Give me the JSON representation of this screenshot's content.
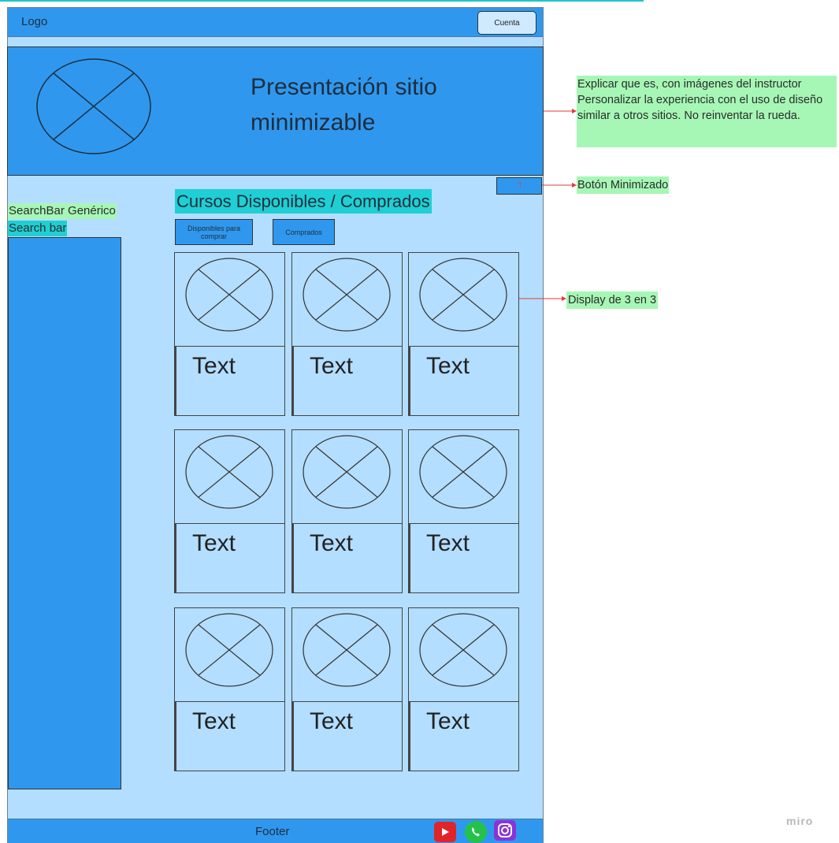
{
  "header": {
    "logo": "Logo",
    "account_button": "Cuenta"
  },
  "hero": {
    "title": "Presentación sitio minimizable"
  },
  "annotations": {
    "hero_note": "Explicar que es, con imágenes del instructor Personalizar la experiencia con el uso de diseño similar a otros sitios. No reinventar la rueda.",
    "minimize_note": "Botón Minimizado",
    "grid_note": "Display de 3 en 3",
    "search_generic": "SearchBar Genérico",
    "search_bar": "Search bar"
  },
  "section": {
    "title": "Cursos Disponibles / Comprados",
    "tabs": [
      "Disponibles para comprar",
      "Comprados"
    ]
  },
  "cards": [
    "Text",
    "Text",
    "Text",
    "Text",
    "Text",
    "Text",
    "Text",
    "Text",
    "Text"
  ],
  "footer": {
    "label": "Footer",
    "social": [
      "youtube-icon",
      "whatsapp-icon",
      "instagram-icon"
    ]
  },
  "watermark": "miro",
  "colors": {
    "primary": "#2f98ee",
    "background": "#b3deff",
    "note": "#a6f7b5",
    "highlight": "#1fcfd4",
    "arrow": "#e53935"
  }
}
